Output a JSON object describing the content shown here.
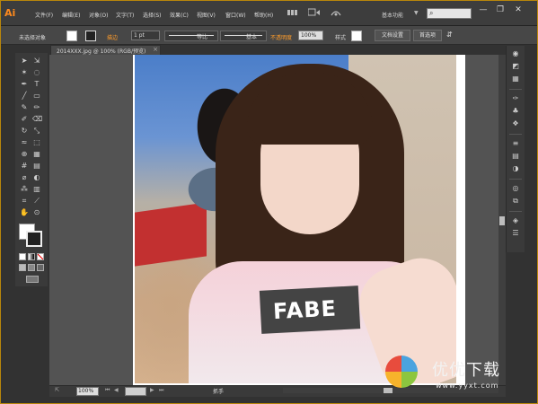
{
  "app": {
    "logo": "Ai"
  },
  "menu": [
    "文件(F)",
    "编辑(E)",
    "对象(O)",
    "文字(T)",
    "选择(S)",
    "效果(C)",
    "视图(V)",
    "窗口(W)",
    "帮助(H)"
  ],
  "workspace": {
    "label": "基本功能",
    "arrow": "▼"
  },
  "window_controls": {
    "minimize": "—",
    "restore": "❐",
    "close": "✕"
  },
  "control_bar": {
    "selection_label": "未选择对象",
    "stroke_label": "描边",
    "stroke_weight": "1 pt",
    "profile_label": "等比",
    "brush_label": "基本",
    "opacity_label": "不透明度",
    "opacity_value": "100%",
    "style_label": "样式",
    "doc_setup": "文档设置",
    "preferences": "首选项"
  },
  "document": {
    "tab_title": "2014XXX.jpg @ 100% (RGB/预览)",
    "close": "×"
  },
  "status": {
    "zoom": "100%",
    "tool_text": "抓手"
  },
  "watermark": {
    "title": "优优下载",
    "url": "www.yyxt.com"
  },
  "colors": {
    "accent": "#ff8a1d",
    "frame": "#b8860b",
    "ui_bg": "#323232"
  },
  "icons": {
    "tools": [
      "selection-tool-icon",
      "direct-selection-tool-icon",
      "magic-wand-icon",
      "lasso-icon",
      "pen-tool-icon",
      "type-tool-icon",
      "line-tool-icon",
      "rectangle-tool-icon",
      "paintbrush-icon",
      "pencil-icon",
      "blob-brush-icon",
      "eraser-icon",
      "rotate-icon",
      "scale-icon",
      "warp-icon",
      "free-transform-icon",
      "shape-builder-icon",
      "perspective-grid-icon",
      "mesh-icon",
      "gradient-icon",
      "eyedropper-icon",
      "blend-icon",
      "symbol-sprayer-icon",
      "column-graph-icon",
      "artboard-icon",
      "slice-icon",
      "hand-icon",
      "zoom-icon"
    ],
    "dock": [
      "color-icon",
      "color-guide-icon",
      "swatches-icon",
      "brushes-icon",
      "symbols-icon",
      "graphic-styles-icon",
      "stroke-icon",
      "gradient-panel-icon",
      "transparency-icon",
      "appearance-icon",
      "layers-icon",
      "artboards-panel-icon"
    ]
  }
}
